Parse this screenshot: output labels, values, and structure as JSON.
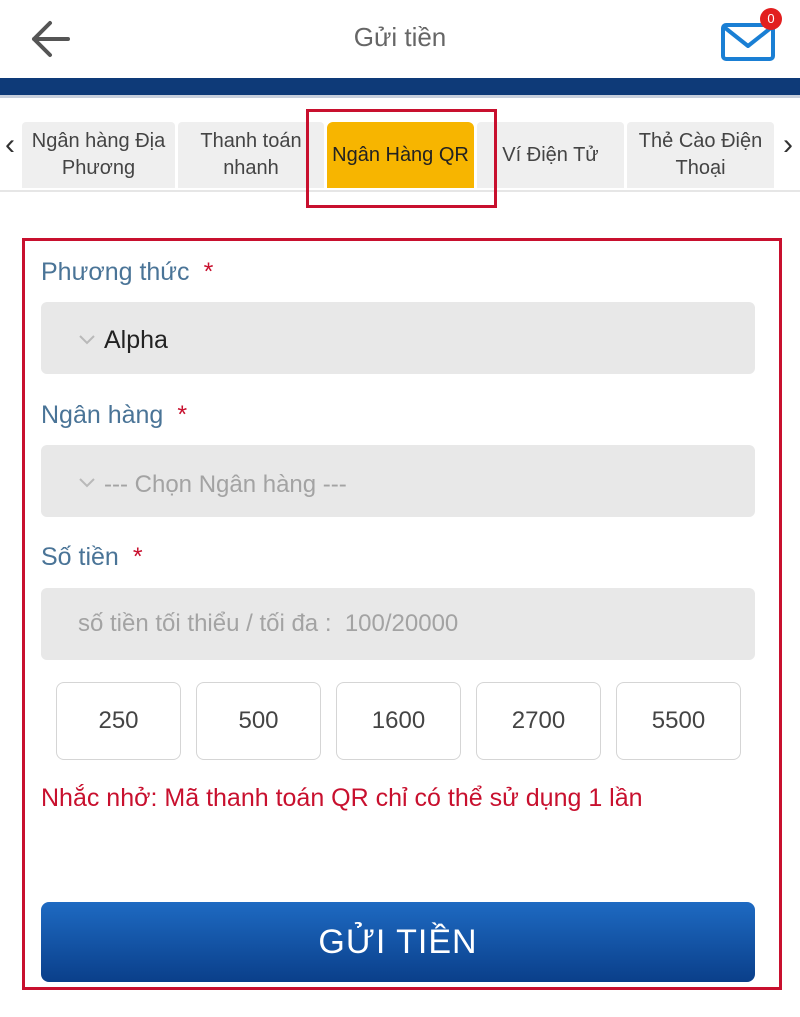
{
  "header": {
    "title": "Gửi tiền",
    "mail_badge": "0"
  },
  "tabs": {
    "prev_arrow": "‹",
    "next_arrow": "›",
    "items": [
      {
        "label": "Ngân hàng Địa Phương",
        "active": false
      },
      {
        "label": "Thanh toán nhanh",
        "active": false
      },
      {
        "label": "Ngân Hàng QR",
        "active": true
      },
      {
        "label": "Ví Điện Tử",
        "active": false
      },
      {
        "label": "Thẻ Cào Điện Thoại",
        "active": false
      }
    ]
  },
  "form": {
    "method_label": "Phương thức",
    "method_value": "Alpha",
    "bank_label": "Ngân hàng",
    "bank_placeholder": "--- Chọn Ngân hàng ---",
    "amount_label": "Số tiền",
    "amount_placeholder": "số tiền tối thiểu / tối đa :  100/20000",
    "required_mark": "*",
    "quick_amounts": [
      "250",
      "500",
      "1600",
      "2700",
      "5500"
    ],
    "note": "Nhắc nhở: Mã thanh toán QR chỉ có thể sử dụng 1 lần",
    "submit_label": "GỬI TIỀN"
  },
  "colors": {
    "accent_blue": "#0e3a78",
    "active_tab": "#f7b500",
    "highlight_red": "#c8102e",
    "label_blue": "#4a7497"
  }
}
